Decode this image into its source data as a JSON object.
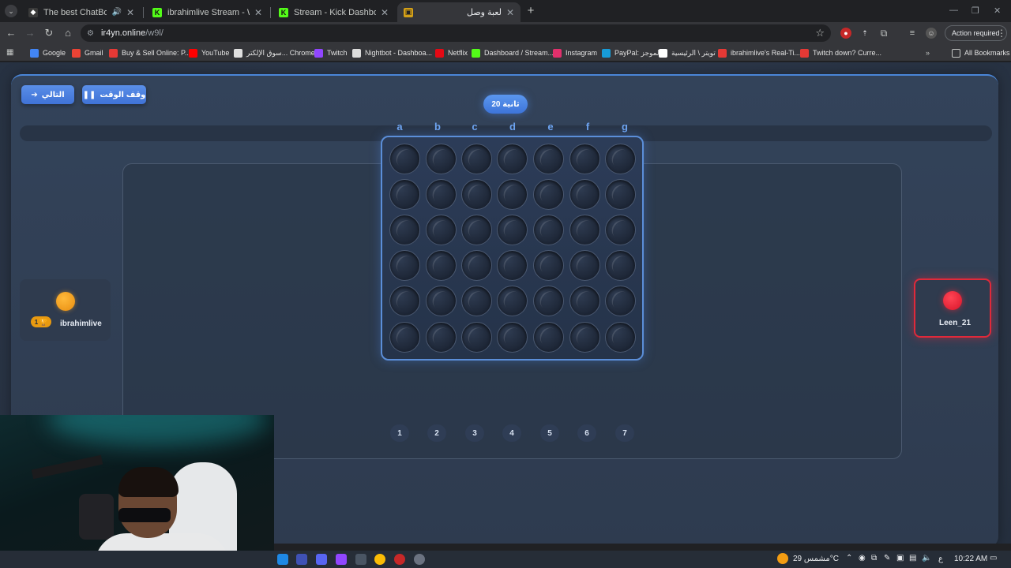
{
  "browser": {
    "tabs": [
      {
        "title": "The best ChatBot and Widg",
        "favicon": "shield-icon",
        "audio": true,
        "active": false
      },
      {
        "title": "ibrahimlive Stream - Watch Liv",
        "favicon": "kick-icon",
        "active": false
      },
      {
        "title": "Stream - Kick Dashboard",
        "favicon": "kick-icon",
        "active": false
      },
      {
        "title": "لعبة وصل",
        "favicon": "game-icon",
        "active": true
      }
    ],
    "address": {
      "host": "ir4yn.online",
      "path": "/w9l/"
    },
    "action_required": "Action required",
    "bookmarks": [
      {
        "label": "Google",
        "icon": "google-icon",
        "color": "#4285f4"
      },
      {
        "label": "Gmail",
        "icon": "gmail-icon",
        "color": "#ea4335"
      },
      {
        "label": "Buy & Sell Online: P...",
        "icon": "shop-icon",
        "color": "#e53935"
      },
      {
        "label": "YouTube",
        "icon": "youtube-icon",
        "color": "#ff0000"
      },
      {
        "label": "سوق الإلكتر... Chrome",
        "icon": "store-icon",
        "color": "#e0e0e0"
      },
      {
        "label": "Twitch",
        "icon": "twitch-icon",
        "color": "#9146ff"
      },
      {
        "label": "Nightbot - Dashboa...",
        "icon": "nightbot-icon",
        "color": "#dddddd"
      },
      {
        "label": "Netflix",
        "icon": "netflix-icon",
        "color": "#e50914"
      },
      {
        "label": "Dashboard / Stream...",
        "icon": "kick-icon",
        "color": "#53fc18"
      },
      {
        "label": "Instagram",
        "icon": "instagram-icon",
        "color": "#e1306c"
      },
      {
        "label": "PayPal: الموجز",
        "icon": "paypal-icon",
        "color": "#179bd7"
      },
      {
        "label": "تويتر \\ الرئيسية",
        "icon": "x-icon",
        "color": "#ffffff"
      },
      {
        "label": "ibrahimlive's Real-Ti...",
        "icon": "chart-icon",
        "color": "#e53935"
      },
      {
        "label": "Twitch down? Curre...",
        "icon": "alert-icon",
        "color": "#e53935"
      }
    ],
    "all_bookmarks": "All Bookmarks"
  },
  "game": {
    "next_button": "التالي",
    "pause_button": "وقف الوقت",
    "timer": "20 ثانية",
    "timer_progress": 0,
    "columns": [
      "a",
      "b",
      "c",
      "d",
      "e",
      "f",
      "g"
    ],
    "column_numbers": [
      "1",
      "2",
      "3",
      "4",
      "5",
      "6",
      "7"
    ],
    "rows": 6,
    "players": [
      {
        "name": "ibrahimlive",
        "disc": "orange",
        "score": "1",
        "active": false
      },
      {
        "name": "Leen_21",
        "disc": "red",
        "active": true
      }
    ],
    "colors": {
      "accent": "#4a86d8",
      "player1": "#f39c12",
      "player2": "#e0293a"
    }
  },
  "taskbar": {
    "weather": "مشمس 29°C",
    "lang": "ع",
    "time": "10:22 AM"
  }
}
